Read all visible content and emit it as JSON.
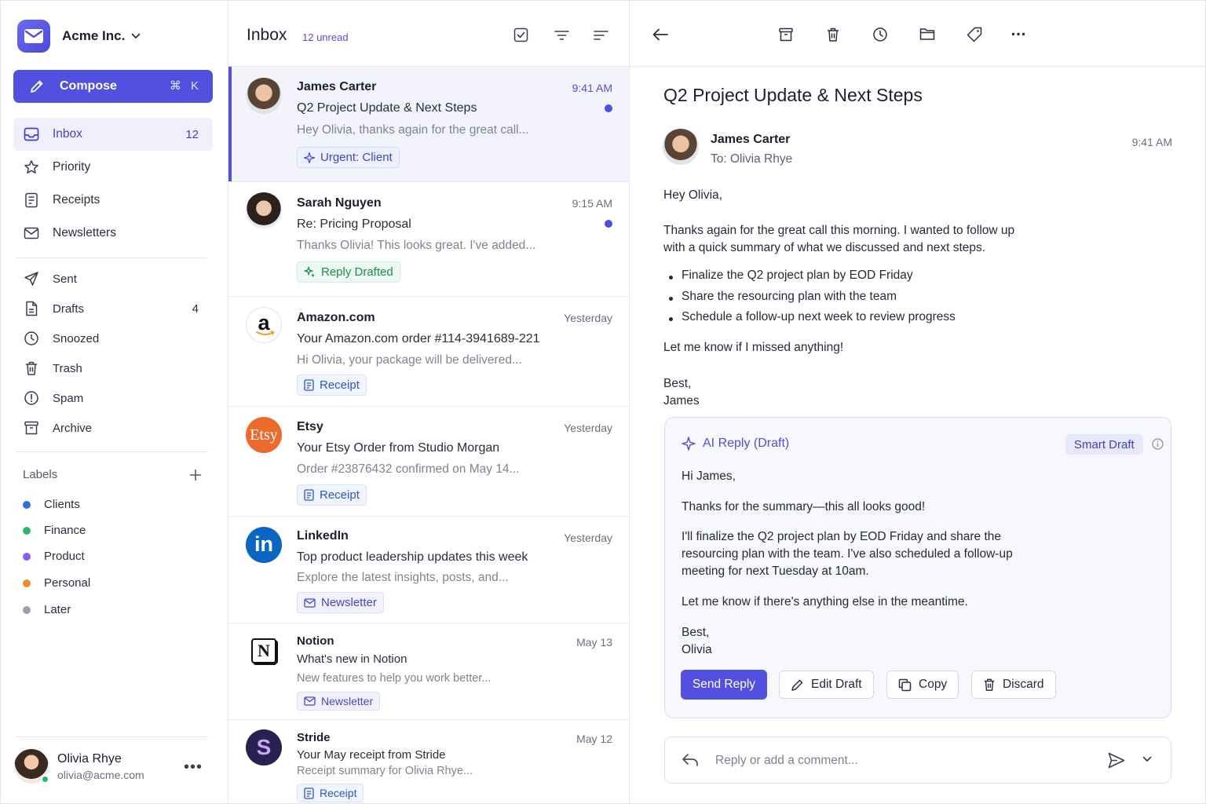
{
  "workspace": {
    "name": "Acme Inc."
  },
  "compose": {
    "label": "Compose",
    "shortcut": "⌘ K"
  },
  "nav": {
    "inbox": {
      "label": "Inbox",
      "count": "12"
    },
    "priority": {
      "label": "Priority"
    },
    "receipts": {
      "label": "Receipts"
    },
    "newsletters": {
      "label": "Newsletters"
    },
    "sent": {
      "label": "Sent"
    },
    "drafts": {
      "label": "Drafts",
      "count": "4"
    },
    "snoozed": {
      "label": "Snoozed"
    },
    "trash": {
      "label": "Trash"
    },
    "spam": {
      "label": "Spam"
    },
    "archive": {
      "label": "Archive"
    }
  },
  "labels": {
    "title": "Labels",
    "items": [
      {
        "name": "Clients",
        "color": "#2f6fe0"
      },
      {
        "name": "Finance",
        "color": "#2cb56b"
      },
      {
        "name": "Product",
        "color": "#8b5cf0"
      },
      {
        "name": "Personal",
        "color": "#f08a2a"
      },
      {
        "name": "Later",
        "color": "#9ca0ab"
      }
    ]
  },
  "user": {
    "name": "Olivia Rhye",
    "email": "olivia@acme.com"
  },
  "inbox": {
    "title": "Inbox",
    "unread": "12 unread",
    "messages": [
      {
        "sender": "James Carter",
        "time": "9:41 AM",
        "subject": "Q2 Project Update & Next Steps",
        "preview": "Hey Olivia, thanks again for the great call...",
        "tag": "Urgent: Client"
      },
      {
        "sender": "Sarah Nguyen",
        "time": "9:15 AM",
        "subject": "Re: Pricing Proposal",
        "preview": "Thanks Olivia! This looks great. I've added...",
        "tag": "Reply Drafted"
      },
      {
        "sender": "Amazon.com",
        "time": "Yesterday",
        "subject": "Your Amazon.com order #114-3941689-221",
        "preview": "Hi Olivia, your package will be delivered...",
        "tag": "Receipt",
        "logo": "a"
      },
      {
        "sender": "Etsy",
        "time": "Yesterday",
        "subject": "Your Etsy Order from Studio Morgan",
        "preview": "Order #23876432 confirmed on May 14...",
        "tag": "Receipt",
        "logo": "Etsy"
      },
      {
        "sender": "LinkedIn",
        "time": "Yesterday",
        "subject": "Top product leadership updates this week",
        "preview": "Explore the latest insights, posts, and...",
        "tag": "Newsletter",
        "logo": "in"
      },
      {
        "sender": "Notion",
        "time": "May 13",
        "subject": "What's new in Notion",
        "preview": "New features to help you work better...",
        "tag": "Newsletter",
        "logo": "N"
      },
      {
        "sender": "Stride",
        "time": "May 12",
        "subject": "Your May receipt from Stride",
        "preview": "Receipt summary for Olivia Rhye...",
        "tag": "Receipt",
        "logo": "S"
      }
    ]
  },
  "email": {
    "subject": "Q2 Project Update & Next Steps",
    "from": "James Carter",
    "to": "To: Olivia Rhye",
    "time": "9:41 AM",
    "greeting": "Hey Olivia,",
    "para1_line1": "Thanks again for the great call this morning. I wanted to follow up",
    "para1_line2": "with a quick summary of what we discussed and next steps.",
    "bullets": [
      "Finalize the Q2 project plan by EOD Friday",
      "Share the resourcing plan with the team",
      "Schedule a follow-up next week to review progress"
    ],
    "closing": "Let me know if I missed anything!",
    "signoff": "Best,",
    "signature": "James"
  },
  "ai_reply": {
    "title": "AI Reply (Draft)",
    "badge": "Smart Draft",
    "greeting": "Hi James,",
    "line1": "Thanks for the summary—this all looks good!",
    "para_line1": "I'll finalize the Q2 project plan by EOD Friday and share the",
    "para_line2": "resourcing plan with the team. I've also scheduled a follow-up",
    "para_line3": "meeting for next Tuesday at 10am.",
    "line3": "Let me know if there's anything else in the meantime.",
    "signoff": "Best,",
    "signature": "Olivia",
    "buttons": {
      "send": "Send Reply",
      "edit": "Edit Draft",
      "copy": "Copy",
      "discard": "Discard"
    }
  },
  "reply": {
    "placeholder": "Reply or add a comment..."
  },
  "colors": {
    "accent": "#5150df",
    "unread_dot": "#4d4fe0",
    "online": "#22b573"
  }
}
